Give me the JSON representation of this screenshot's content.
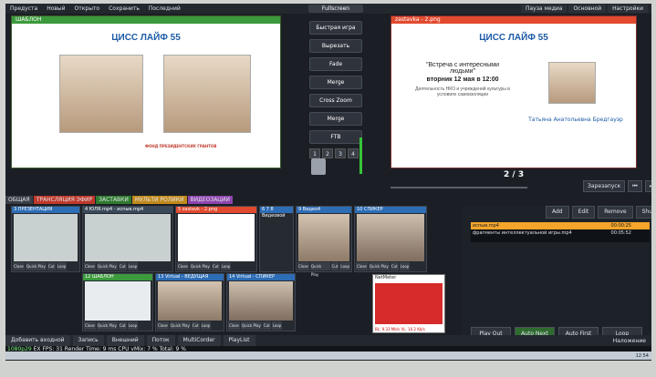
{
  "menu": {
    "left": [
      "Предуста",
      "Новый",
      "Открыто",
      "Сохранить",
      "Последний"
    ],
    "fullscreen": "Fullscreen",
    "right": [
      "Пауза медиа",
      "Основной",
      "Настройки"
    ]
  },
  "preview": {
    "label": "ШАБЛОН",
    "slide_title": "ЦИСС ЛАЙФ 55",
    "fond": "ФОНД ПРЕЗИДЕНТСКИХ ГРАНТОВ"
  },
  "output": {
    "label": "zastavka - 2.png",
    "slide_title": "ЦИСС ЛАЙФ 55",
    "title_line1": "\"Встреча с интересными",
    "title_line2": "людьми\"",
    "date": "вторник 12 мая в 12:00",
    "subtitle": "Деятельность НКО и учреждений культуры в условиях самоизоляции",
    "person_name": "Татьяна Анатольевна Бредгауэр"
  },
  "controls": {
    "buttons": [
      "Быстрая игра",
      "Вырезать",
      "Fade",
      "Merge",
      "Cross Zoom",
      "Merge",
      "FTB"
    ],
    "numbers": [
      "1",
      "2",
      "3",
      "4"
    ]
  },
  "pager": "2 / 3",
  "transport": [
    "Зарезапуск",
    "⏮",
    "⏭",
    "▶"
  ],
  "tabs": [
    "ОБЩАЯ",
    "ТРАНСЛЯЦИЯ ЭФИР",
    "ЗАСТАВКИ",
    "МУЛЬТИ РОЛИКИ",
    "ВИДЕОЗАЦИИ"
  ],
  "inputs": [
    {
      "title": "3 ПРЕЗЕНТАЦИЯ",
      "color": "#2d6db5"
    },
    {
      "title": "4 ЮЛЯ.mp4 - испыв.mp4",
      "color": "#3a4a5a"
    },
    {
      "title": "5 zastavk - 2.png",
      "color": "#e14a2f"
    },
    {
      "title": "6 7 8 Видеовой",
      "color": "#2d6db5"
    },
    {
      "title": "9 Видео4",
      "color": "#2d6db5"
    },
    {
      "title": "10 СПИКЕР",
      "color": "#2d6db5"
    },
    {
      "title": "12 ШАБЛОН",
      "color": "#3c9a3c"
    },
    {
      "title": "13 Virtual - ВЕДУЩАЯ",
      "color": "#2d6db5"
    },
    {
      "title": "14 Virtual - СПИКЕР",
      "color": "#2d6db5"
    }
  ],
  "input_buttons": [
    "Close",
    "Quick Play",
    "Cut",
    "Loop"
  ],
  "netmeter": {
    "title": "NetMeter",
    "readout": "BL: 9.33 Mb/s  VL: 10.2 Kb/s"
  },
  "playlist": {
    "buttons": [
      "Add",
      "Edit",
      "Remove",
      "Shuffle"
    ],
    "items": [
      {
        "name": "испыв.mp4",
        "dur": "00:00:25",
        "active": true
      },
      {
        "name": "фрагменты интеллектуальной игры.mp4",
        "dur": "00:05:52",
        "active": false
      }
    ],
    "footer": [
      "Play Out",
      "Auto Next",
      "Auto First",
      "Loop"
    ]
  },
  "bottom": {
    "items": [
      "Добавить входной",
      "Запись",
      "Внешний",
      "Поток",
      "MultiCorder",
      "PlayList"
    ],
    "right": "Наложение"
  },
  "status": {
    "fps": "1080p29",
    "text": "EX FPS: 31 Render Time: 9 ms CPU vMix: 7 % Total: 9 %"
  },
  "taskbar": {
    "time": "12:54"
  }
}
